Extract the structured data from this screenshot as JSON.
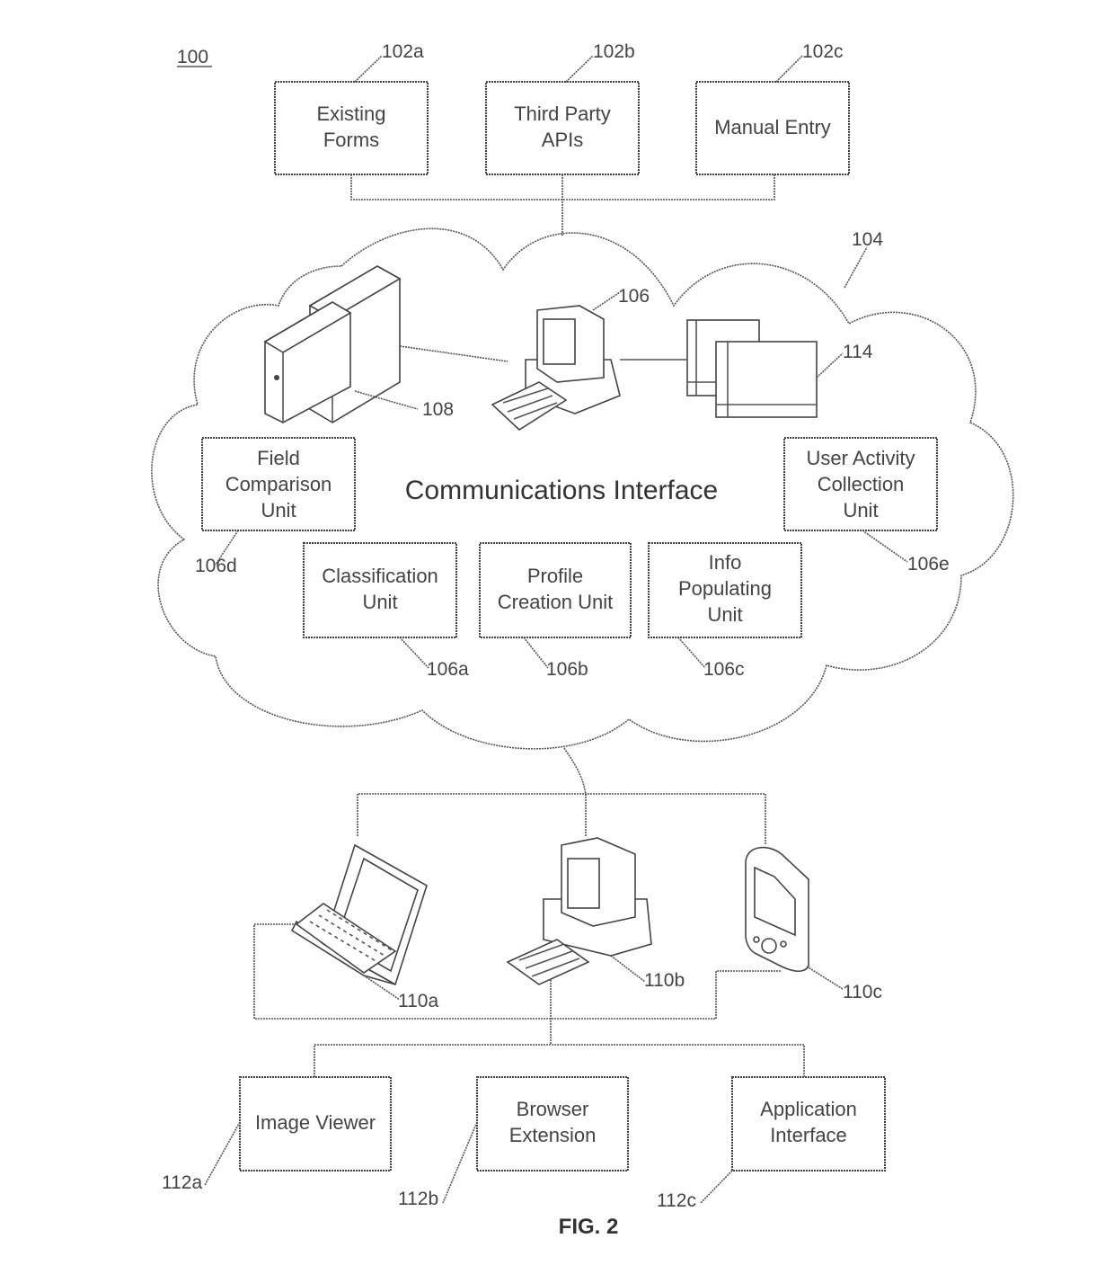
{
  "figure": {
    "system_ref": "100",
    "caption": "FIG. 2"
  },
  "sources": [
    {
      "ref": "102a",
      "lines": [
        "Existing",
        "Forms"
      ]
    },
    {
      "ref": "102b",
      "lines": [
        "Third Party",
        "APIs"
      ]
    },
    {
      "ref": "102c",
      "lines": [
        "Manual Entry"
      ]
    }
  ],
  "cloud": {
    "ref": "104",
    "label": "Communications Interface",
    "server_ref": "108",
    "computer_ref": "106",
    "documents_ref": "114",
    "units": [
      {
        "ref": "106d",
        "lines": [
          "Field",
          "Comparison",
          "Unit"
        ]
      },
      {
        "ref": "106e",
        "lines": [
          "User Activity",
          "Collection",
          "Unit"
        ]
      },
      {
        "ref": "106a",
        "lines": [
          "Classification",
          "Unit"
        ]
      },
      {
        "ref": "106b",
        "lines": [
          "Profile",
          "Creation Unit"
        ]
      },
      {
        "ref": "106c",
        "lines": [
          "Info",
          "Populating",
          "Unit"
        ]
      }
    ]
  },
  "devices": [
    {
      "ref": "110a",
      "type": "laptop-icon"
    },
    {
      "ref": "110b",
      "type": "desktop-computer-icon"
    },
    {
      "ref": "110c",
      "type": "mobile-device-icon"
    }
  ],
  "interfaces": [
    {
      "ref": "112a",
      "lines": [
        "Image Viewer"
      ]
    },
    {
      "ref": "112b",
      "lines": [
        "Browser",
        "Extension"
      ]
    },
    {
      "ref": "112c",
      "lines": [
        "Application",
        "Interface"
      ]
    }
  ]
}
